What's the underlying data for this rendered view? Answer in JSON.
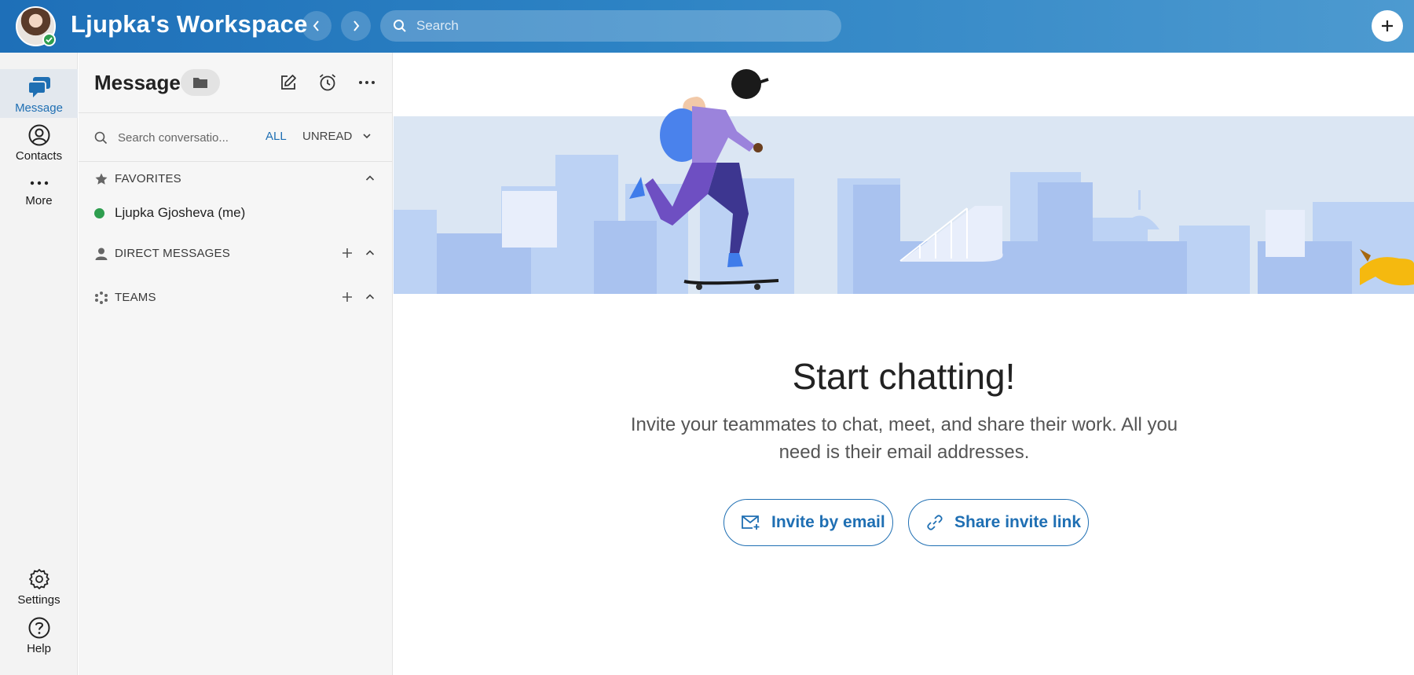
{
  "header": {
    "workspace_title": "Ljupka's Workspace",
    "search_placeholder": "Search"
  },
  "rail": {
    "message": "Message",
    "contacts": "Contacts",
    "more": "More",
    "settings": "Settings",
    "help": "Help"
  },
  "sidebar": {
    "title": "Message",
    "search_placeholder": "Search conversatio...",
    "filter_all": "ALL",
    "filter_unread": "UNREAD",
    "sections": {
      "favorites": "FAVORITES",
      "direct_messages": "DIRECT MESSAGES",
      "teams": "TEAMS"
    },
    "favorite_user": "Ljupka Gjosheva (me)"
  },
  "main": {
    "headline": "Start chatting!",
    "subtext": "Invite your teammates to chat, meet, and share their work. All you need is their email addresses.",
    "invite_email": "Invite by email",
    "share_link": "Share invite link"
  },
  "colors": {
    "accent": "#1f6fb3",
    "online": "#2e9e4f",
    "topbar": "#2d83c4"
  }
}
